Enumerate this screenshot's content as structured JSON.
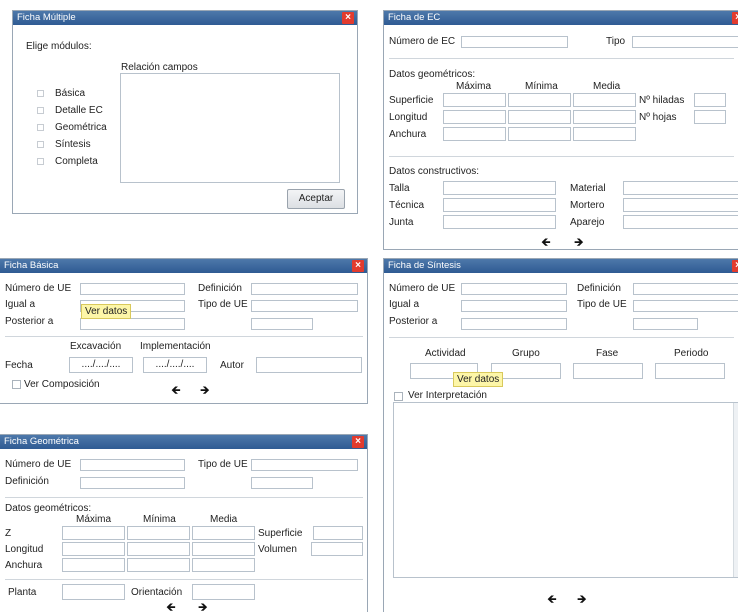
{
  "multiple": {
    "title": "Ficha Múltiple",
    "choose_modules": "Elige módulos:",
    "relation_fields": "Relación campos",
    "modules": [
      "Básica",
      "Detalle EC",
      "Geométrica",
      "Síntesis",
      "Completa"
    ],
    "accept": "Aceptar"
  },
  "ec": {
    "title": "Ficha de EC",
    "number": "Número de EC",
    "type": "Tipo",
    "geo_heading": "Datos geométricos:",
    "col_max": "Máxima",
    "col_min": "Mínima",
    "col_avg": "Media",
    "surface": "Superficie",
    "length": "Longitud",
    "width": "Anchura",
    "rows": "Nº hiladas",
    "sheets": "Nº hojas",
    "constr_heading": "Datos constructivos:",
    "talla": "Talla",
    "tecnica": "Técnica",
    "junta": "Junta",
    "material": "Material",
    "mortero": "Mortero",
    "aparejo": "Aparejo"
  },
  "basica": {
    "title": "Ficha Básica",
    "ue_number": "Número de UE",
    "definition": "Definición",
    "equal_to": "Igual a",
    "ue_type": "Tipo de UE",
    "later_than": "Posterior a",
    "tooltip": "Ver datos",
    "excavation": "Excavación",
    "implementation": "Implementación",
    "date": "Fecha",
    "date_value1": "..../..../....",
    "date_value2": "..../..../....",
    "author": "Autor",
    "view_composition": "Ver Composición"
  },
  "sintesis": {
    "title": "Ficha de Síntesis",
    "ue_number": "Número de UE",
    "definition": "Definición",
    "equal_to": "Igual a",
    "ue_type": "Tipo de UE",
    "later_than": "Posterior a",
    "activity": "Actividad",
    "group": "Grupo",
    "phase": "Fase",
    "period": "Periodo",
    "tooltip": "Ver datos",
    "view_interpretation": "Ver Interpretación"
  },
  "geometrica": {
    "title": "Ficha Geométrica",
    "ue_number": "Número de UE",
    "ue_type": "Tipo de UE",
    "definition": "Definición",
    "geo_heading": "Datos geométricos:",
    "col_max": "Máxima",
    "col_min": "Mínima",
    "col_avg": "Media",
    "z": "Z",
    "length": "Longitud",
    "width": "Anchura",
    "surface": "Superficie",
    "volume": "Volumen",
    "plan": "Planta",
    "orientation": "Orientación"
  },
  "icons": {
    "close": "×",
    "prev": "🡸",
    "next": "🡺"
  }
}
